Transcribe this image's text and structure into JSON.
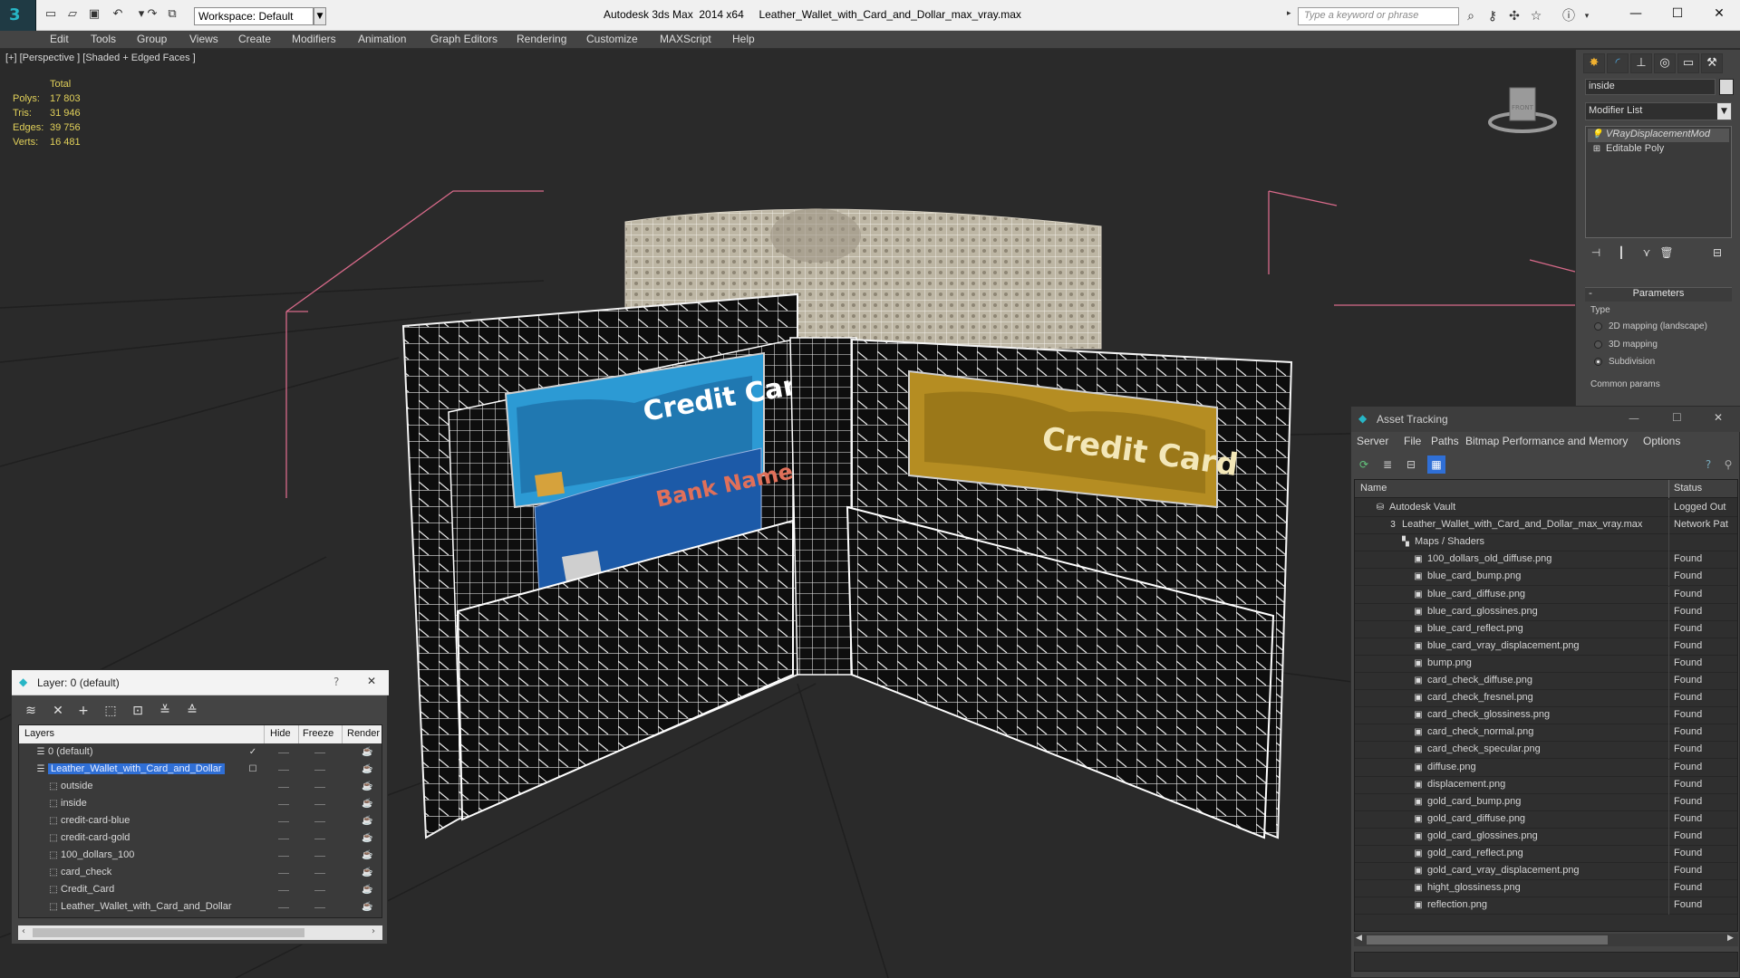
{
  "titlebar": {
    "app_title": "Autodesk 3ds Max  2014 x64",
    "file_title": "Leather_Wallet_with_Card_and_Dollar_max_vray.max",
    "workspace": "Workspace: Default",
    "search_placeholder": "Type a keyword or phrase"
  },
  "menubar": [
    "Edit",
    "Tools",
    "Group",
    "Views",
    "Create",
    "Modifiers",
    "Animation",
    "Graph Editors",
    "Rendering",
    "Customize",
    "MAXScript",
    "Help"
  ],
  "viewport": {
    "label": "[+] [Perspective ] [Shaded + Edged Faces ]",
    "stats": {
      "header": "Total",
      "rows": [
        {
          "key": "Polys:",
          "value": "17 803"
        },
        {
          "key": "Tris:",
          "value": "31 946"
        },
        {
          "key": "Edges:",
          "value": "39 756"
        },
        {
          "key": "Verts:",
          "value": "16 481"
        }
      ]
    },
    "scene_text": {
      "credit_card_blue": "Credit Card",
      "bank_name": "Bank Name",
      "credit_card_gold": "Credit Card"
    },
    "viewcube_label": "FRONT"
  },
  "command_panel": {
    "object_name": "inside",
    "modifier_list": "Modifier List",
    "stack": [
      "VRayDisplacementMod",
      "Editable Poly"
    ],
    "parameters_title": "Parameters",
    "type_label": "Type",
    "options": [
      {
        "label": "2D mapping (landscape)",
        "selected": false
      },
      {
        "label": "3D mapping",
        "selected": false
      },
      {
        "label": "Subdivision",
        "selected": true
      }
    ],
    "common_params": "Common params"
  },
  "asset_tracking": {
    "title": "Asset Tracking",
    "menu": [
      "Server",
      "File",
      "Paths",
      "Bitmap Performance and Memory",
      "Options"
    ],
    "columns": [
      "Name",
      "Status"
    ],
    "rows": [
      {
        "name": "Autodesk Vault",
        "status": "Logged Out",
        "level": 0,
        "icon": "vault-icon"
      },
      {
        "name": "Leather_Wallet_with_Card_and_Dollar_max_vray.max",
        "status": "Network Pat",
        "level": 1,
        "icon": "max-file-icon"
      },
      {
        "name": "Maps / Shaders",
        "status": "",
        "level": 2,
        "icon": "maps-icon"
      },
      {
        "name": "100_dollars_old_diffuse.png",
        "status": "Found",
        "level": 3,
        "icon": "bitmap-icon"
      },
      {
        "name": "blue_card_bump.png",
        "status": "Found",
        "level": 3,
        "icon": "bitmap-icon"
      },
      {
        "name": "blue_card_diffuse.png",
        "status": "Found",
        "level": 3,
        "icon": "bitmap-icon"
      },
      {
        "name": "blue_card_glossines.png",
        "status": "Found",
        "level": 3,
        "icon": "bitmap-icon"
      },
      {
        "name": "blue_card_reflect.png",
        "status": "Found",
        "level": 3,
        "icon": "bitmap-icon"
      },
      {
        "name": "blue_card_vray_displacement.png",
        "status": "Found",
        "level": 3,
        "icon": "bitmap-icon"
      },
      {
        "name": "bump.png",
        "status": "Found",
        "level": 3,
        "icon": "bitmap-icon"
      },
      {
        "name": "card_check_diffuse.png",
        "status": "Found",
        "level": 3,
        "icon": "bitmap-icon"
      },
      {
        "name": "card_check_fresnel.png",
        "status": "Found",
        "level": 3,
        "icon": "bitmap-icon"
      },
      {
        "name": "card_check_glossiness.png",
        "status": "Found",
        "level": 3,
        "icon": "bitmap-icon"
      },
      {
        "name": "card_check_normal.png",
        "status": "Found",
        "level": 3,
        "icon": "bitmap-icon"
      },
      {
        "name": "card_check_specular.png",
        "status": "Found",
        "level": 3,
        "icon": "bitmap-icon"
      },
      {
        "name": "diffuse.png",
        "status": "Found",
        "level": 3,
        "icon": "bitmap-icon"
      },
      {
        "name": "displacement.png",
        "status": "Found",
        "level": 3,
        "icon": "bitmap-icon"
      },
      {
        "name": "gold_card_bump.png",
        "status": "Found",
        "level": 3,
        "icon": "bitmap-icon"
      },
      {
        "name": "gold_card_diffuse.png",
        "status": "Found",
        "level": 3,
        "icon": "bitmap-icon"
      },
      {
        "name": "gold_card_glossines.png",
        "status": "Found",
        "level": 3,
        "icon": "bitmap-icon"
      },
      {
        "name": "gold_card_reflect.png",
        "status": "Found",
        "level": 3,
        "icon": "bitmap-icon"
      },
      {
        "name": "gold_card_vray_displacement.png",
        "status": "Found",
        "level": 3,
        "icon": "bitmap-icon"
      },
      {
        "name": "hight_glossiness.png",
        "status": "Found",
        "level": 3,
        "icon": "bitmap-icon"
      },
      {
        "name": "reflection.png",
        "status": "Found",
        "level": 3,
        "icon": "bitmap-icon"
      }
    ]
  },
  "layers": {
    "title": "Layer: 0 (default)",
    "help": "?",
    "columns": [
      "Layers",
      "Hide",
      "Freeze",
      "Render"
    ],
    "rows": [
      {
        "name": "0 (default)",
        "level": 0,
        "selected": false,
        "current": true
      },
      {
        "name": "Leather_Wallet_with_Card_and_Dollar",
        "level": 0,
        "selected": true,
        "current": false
      },
      {
        "name": "outside",
        "level": 1,
        "selected": false,
        "current": false
      },
      {
        "name": "inside",
        "level": 1,
        "selected": false,
        "current": false
      },
      {
        "name": "credit-card-blue",
        "level": 1,
        "selected": false,
        "current": false
      },
      {
        "name": "credit-card-gold",
        "level": 1,
        "selected": false,
        "current": false
      },
      {
        "name": "100_dollars_100",
        "level": 1,
        "selected": false,
        "current": false
      },
      {
        "name": "card_check",
        "level": 1,
        "selected": false,
        "current": false
      },
      {
        "name": "Credit_Card",
        "level": 1,
        "selected": false,
        "current": false
      },
      {
        "name": "Leather_Wallet_with_Card_and_Dollar",
        "level": 1,
        "selected": false,
        "current": false
      }
    ]
  },
  "colors": {
    "stats_yellow": "#e2d15a",
    "selection_blue": "#2f6fd6",
    "grid_pink": "#d86a8a",
    "accent_teal": "#27b6c6"
  }
}
